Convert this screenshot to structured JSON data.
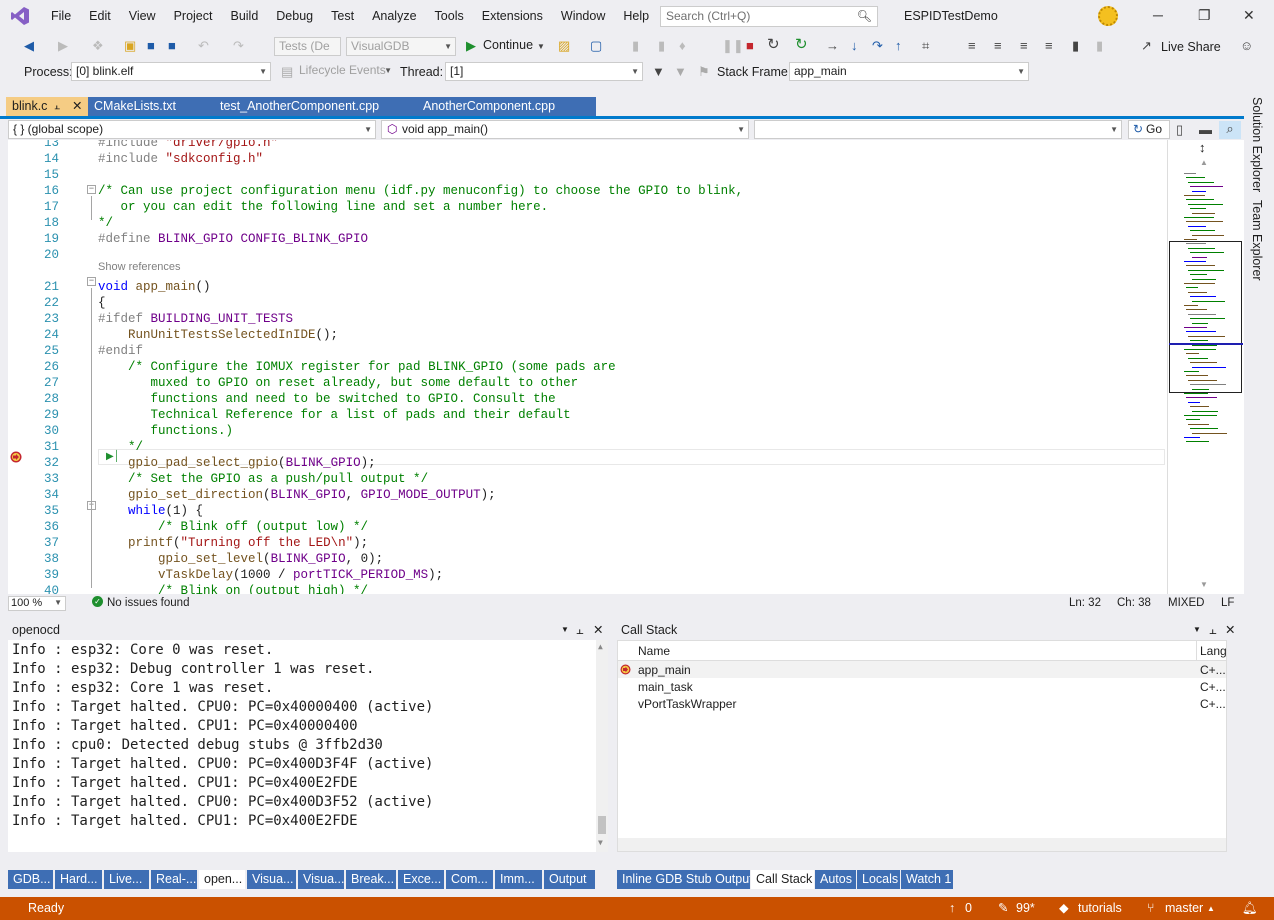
{
  "menu": [
    "File",
    "Edit",
    "View",
    "Project",
    "Build",
    "Debug",
    "Test",
    "Analyze",
    "Tools",
    "Extensions",
    "Window",
    "Help"
  ],
  "search": {
    "placeholder": "Search (Ctrl+Q)"
  },
  "solution_name": "ESPIDTestDemo",
  "toolbar": {
    "config": "Tests (De",
    "platform": "VisualGDB",
    "continue": "Continue",
    "live_share": "Live Share"
  },
  "debugbar": {
    "process_label": "Process:",
    "process_value": "[0] blink.elf",
    "lifecycle": "Lifecycle Events",
    "thread_label": "Thread:",
    "thread_value": "[1]",
    "stackframe_label": "Stack Frame:",
    "stackframe_value": "app_main"
  },
  "tabs": [
    "blink.c",
    "CMakeLists.txt",
    "test_AnotherComponent.cpp",
    "AnotherComponent.cpp"
  ],
  "nav": {
    "scope": "{ } (global scope)",
    "function": "void app_main()",
    "go": "Go"
  },
  "code": {
    "lines": [
      {
        "n": "13",
        "s": [
          [
            "pp",
            "#include "
          ],
          [
            "str",
            "\"driver/gpio.h\""
          ]
        ]
      },
      {
        "n": "14",
        "s": [
          [
            "pp",
            "#include "
          ],
          [
            "str",
            "\"sdkconfig.h\""
          ]
        ]
      },
      {
        "n": "15",
        "s": []
      },
      {
        "n": "16",
        "s": [
          [
            "com",
            "/* Can use project configuration menu (idf.py menuconfig) to choose the GPIO to blink,"
          ]
        ]
      },
      {
        "n": "17",
        "s": [
          [
            "com",
            "   or you can edit the following line and set a number here."
          ]
        ]
      },
      {
        "n": "18",
        "s": [
          [
            "com",
            "*/"
          ]
        ]
      },
      {
        "n": "19",
        "s": [
          [
            "pp",
            "#define "
          ],
          [
            "mac",
            "BLINK_GPIO CONFIG_BLINK_GPIO"
          ]
        ]
      },
      {
        "n": "20",
        "s": []
      },
      {
        "n": "21",
        "s": [
          [
            "kw",
            "void "
          ],
          [
            "fn",
            "app_main"
          ],
          [
            "",
            "()"
          ]
        ]
      },
      {
        "n": "22",
        "s": [
          [
            "",
            "{"
          ]
        ]
      },
      {
        "n": "23",
        "s": [
          [
            "pp",
            "#ifdef "
          ],
          [
            "mac",
            "BUILDING_UNIT_TESTS"
          ]
        ]
      },
      {
        "n": "24",
        "s": [
          [
            "",
            "    "
          ],
          [
            "fn",
            "RunUnitTestsSelectedInIDE"
          ],
          [
            "",
            "();"
          ]
        ]
      },
      {
        "n": "25",
        "s": [
          [
            "pp",
            "#endif"
          ]
        ]
      },
      {
        "n": "26",
        "s": [
          [
            "",
            "    "
          ],
          [
            "com",
            "/* Configure the IOMUX register for pad BLINK_GPIO (some pads are"
          ]
        ]
      },
      {
        "n": "27",
        "s": [
          [
            "com",
            "       muxed to GPIO on reset already, but some default to other"
          ]
        ]
      },
      {
        "n": "28",
        "s": [
          [
            "com",
            "       functions and need to be switched to GPIO. Consult the"
          ]
        ]
      },
      {
        "n": "29",
        "s": [
          [
            "com",
            "       Technical Reference for a list of pads and their default"
          ]
        ]
      },
      {
        "n": "30",
        "s": [
          [
            "com",
            "       functions.)"
          ]
        ]
      },
      {
        "n": "31",
        "s": [
          [
            "com",
            "    */"
          ]
        ]
      },
      {
        "n": "32",
        "s": [
          [
            "",
            "    "
          ],
          [
            "fn",
            "gpio_pad_select_gpio"
          ],
          [
            "",
            "("
          ],
          [
            "mac",
            "BLINK_GPIO"
          ],
          [
            "",
            ");"
          ]
        ]
      },
      {
        "n": "33",
        "s": [
          [
            "",
            "    "
          ],
          [
            "com",
            "/* Set the GPIO as a push/pull output */"
          ]
        ]
      },
      {
        "n": "34",
        "s": [
          [
            "",
            "    "
          ],
          [
            "fn",
            "gpio_set_direction"
          ],
          [
            "",
            "("
          ],
          [
            "mac",
            "BLINK_GPIO"
          ],
          [
            "",
            ", "
          ],
          [
            "mac",
            "GPIO_MODE_OUTPUT"
          ],
          [
            "",
            ");"
          ]
        ]
      },
      {
        "n": "35",
        "s": [
          [
            "",
            "    "
          ],
          [
            "kw",
            "while"
          ],
          [
            "",
            "(1) {"
          ]
        ]
      },
      {
        "n": "36",
        "s": [
          [
            "",
            "        "
          ],
          [
            "com",
            "/* Blink off (output low) */"
          ]
        ]
      },
      {
        "n": "37",
        "s": [
          [
            "",
            "    "
          ],
          [
            "fn",
            "printf"
          ],
          [
            "",
            "("
          ],
          [
            "str",
            "\"Turning off the LED\\n\""
          ],
          [
            "",
            ");"
          ]
        ]
      },
      {
        "n": "38",
        "s": [
          [
            "",
            "        "
          ],
          [
            "fn",
            "gpio_set_level"
          ],
          [
            "",
            "("
          ],
          [
            "mac",
            "BLINK_GPIO"
          ],
          [
            "",
            ", 0);"
          ]
        ]
      },
      {
        "n": "39",
        "s": [
          [
            "",
            "        "
          ],
          [
            "fn",
            "vTaskDelay"
          ],
          [
            "",
            "(1000 / "
          ],
          [
            "mac",
            "portTICK_PERIOD_MS"
          ],
          [
            "",
            ");"
          ]
        ]
      },
      {
        "n": "40",
        "s": [
          [
            "",
            "        "
          ],
          [
            "com",
            "/* Blink on (output high) */"
          ]
        ]
      }
    ],
    "show_references": "Show references"
  },
  "editor_status": {
    "zoom": "100 %",
    "issues": "No issues found",
    "ln": "Ln: 32",
    "ch": "Ch: 38",
    "eol_mode": "MIXED",
    "eol": "LF"
  },
  "side_tabs": [
    "Solution Explorer",
    "Team Explorer"
  ],
  "output_panel": {
    "title": "openocd",
    "lines": [
      "Info : esp32: Core 0 was reset.",
      "Info : esp32: Debug controller 1 was reset.",
      "Info : esp32: Core 1 was reset.",
      "Info : Target halted. CPU0: PC=0x40000400 (active)",
      "Info : Target halted. CPU1: PC=0x40000400",
      "Info : cpu0: Detected debug stubs @ 3ffb2d30",
      "Info : Target halted. CPU0: PC=0x400D3F4F (active)",
      "Info : Target halted. CPU1: PC=0x400E2FDE",
      "Info : Target halted. CPU0: PC=0x400D3F52 (active)",
      "Info : Target halted. CPU1: PC=0x400E2FDE"
    ]
  },
  "callstack": {
    "title": "Call Stack",
    "columns": [
      "Name",
      "Lang"
    ],
    "rows": [
      {
        "name": "app_main",
        "lang": "C+..."
      },
      {
        "name": "main_task",
        "lang": "C+..."
      },
      {
        "name": "vPortTaskWrapper",
        "lang": "C+..."
      }
    ]
  },
  "bottom_tabs_left": [
    "GDB...",
    "Hard...",
    "Live...",
    "Real-...",
    "open...",
    "Visua...",
    "Visua...",
    "Break...",
    "Exce...",
    "Com...",
    "Imm...",
    "Output"
  ],
  "bottom_tabs_right": [
    "Inline GDB Stub Output",
    "Call Stack",
    "Autos",
    "Locals",
    "Watch 1"
  ],
  "statusbar": {
    "ready": "Ready",
    "up_count": "0",
    "edits": "99*",
    "repo": "tutorials",
    "branch": "master"
  },
  "colors": {
    "accent": "#007acc",
    "status": "#ca5100",
    "tab_active": "#f5cc84",
    "tab_inactive": "#3e6eb4"
  }
}
